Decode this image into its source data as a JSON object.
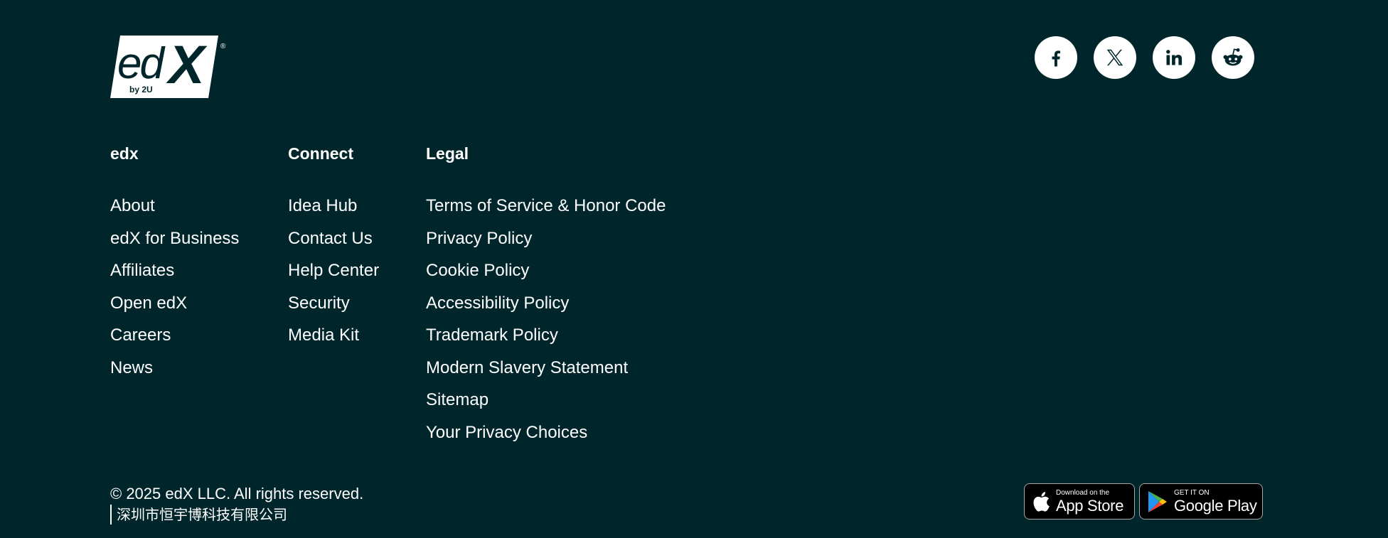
{
  "logo": {
    "main": "ed",
    "x": "X",
    "by": "by 2U",
    "reg": "®"
  },
  "social": [
    {
      "name": "facebook",
      "icon": "facebook-icon"
    },
    {
      "name": "x",
      "icon": "x-icon"
    },
    {
      "name": "linkedin",
      "icon": "linkedin-icon"
    },
    {
      "name": "reddit",
      "icon": "reddit-icon"
    }
  ],
  "columns": {
    "edx": {
      "heading": "edx",
      "links": [
        "About",
        "edX for Business",
        "Affiliates",
        "Open edX",
        "Careers",
        "News"
      ]
    },
    "connect": {
      "heading": "Connect",
      "links": [
        "Idea Hub",
        "Contact Us",
        "Help Center",
        "Security",
        "Media Kit"
      ]
    },
    "legal": {
      "heading": "Legal",
      "links": [
        "Terms of Service & Honor Code",
        "Privacy Policy",
        "Cookie Policy",
        "Accessibility Policy",
        "Trademark Policy",
        "Modern Slavery Statement",
        "Sitemap",
        "Your Privacy Choices"
      ]
    }
  },
  "footer": {
    "copyright": "© 2025 edX LLC. All rights reserved.",
    "icp": "深圳市恒宇博科技有限公司"
  },
  "badges": {
    "apple": {
      "small": "Download on the",
      "big": "App Store"
    },
    "google": {
      "small": "GET IT ON",
      "big": "Google Play"
    }
  },
  "colors": {
    "background": "#00262b",
    "text": "#ffffff"
  }
}
